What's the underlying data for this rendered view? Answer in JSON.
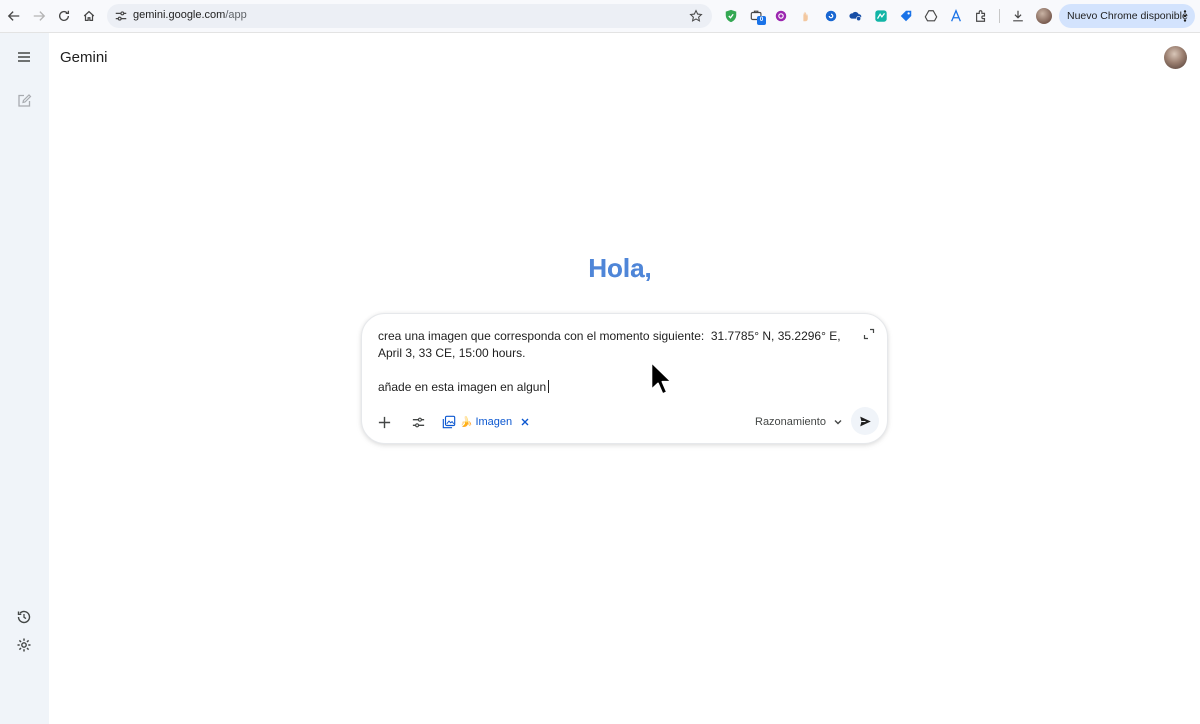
{
  "browser": {
    "url_host": "gemini.google.com",
    "url_path": "/app",
    "update_label": "Nuevo Chrome disponible",
    "extension_badge": "0",
    "extensions": [
      "shield-extension-icon",
      "briefcase-extension-icon",
      "purple-extension-icon",
      "hand-extension-icon",
      "blue-circle-extension-icon",
      "cloud-key-extension-icon",
      "green-extension-icon",
      "tag-extension-icon",
      "drive-extension-icon",
      "a-extension-icon",
      "puzzle-icon",
      "download-icon"
    ]
  },
  "app": {
    "title": "Gemini",
    "greeting": "Hola,"
  },
  "composer": {
    "prompt_line1": "crea una imagen que corresponda con el momento siguiente:  31.7785° N, 35.2296° E, April 3, 33 CE, 15:00 hours.",
    "prompt_line2": "añade en esta imagen en algun",
    "tool_chip_label": "Imagen",
    "model_label": "Razonamiento"
  },
  "colors": {
    "greeting": "#4f86d8",
    "accent": "#0b57d0",
    "rail_bg": "#f0f4f9",
    "update_pill": "#d3e3fd"
  }
}
